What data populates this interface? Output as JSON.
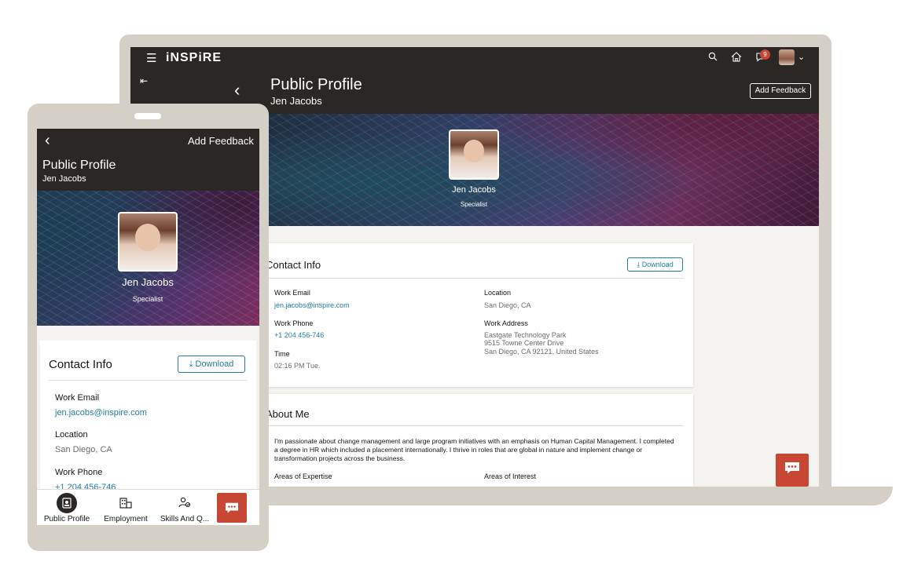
{
  "desktop": {
    "app_name": "iNSPiRE",
    "notification_count": "9",
    "page_title": "Public Profile",
    "page_subtitle": "Jen Jacobs",
    "add_feedback_label": "Add Feedback",
    "profile": {
      "name": "Jen Jacobs",
      "role": "Specialist"
    },
    "contact": {
      "title": "Contact Info",
      "download_label": "Download",
      "work_email_label": "Work Email",
      "work_email": "jen.jacobs@inspire.com",
      "work_phone_label": "Work Phone",
      "work_phone": "+1 204 456-746",
      "time_label": "Time",
      "time": "02:16 PM Tue.",
      "location_label": "Location",
      "location": "San Diego, CA",
      "work_address_label": "Work Address",
      "address_line1": "Eastgate Technology Park",
      "address_line2": "9515 Towne Center Drive",
      "address_line3": "San Diego, CA 92121, United States"
    },
    "about": {
      "title": "About Me",
      "text": "I'm passionate about change management and large program initiatives with an emphasis on Human Capital Management. I completed a degree in HR which included a placement internationally. I thrive in roles that are global in nature and implement change or transformation projects across the business.",
      "areas_of_expertise_label": "Areas of Expertise",
      "areas_of_interest_label": "Areas of Interest"
    }
  },
  "mobile": {
    "add_feedback_label": "Add Feedback",
    "page_title": "Public Profile",
    "page_subtitle": "Jen Jacobs",
    "profile": {
      "name": "Jen Jacobs",
      "role": "Specialist"
    },
    "contact": {
      "title": "Contact Info",
      "download_label": "Download",
      "work_email_label": "Work Email",
      "work_email": "jen.jacobs@inspire.com",
      "location_label": "Location",
      "location": "San Diego, CA",
      "work_phone_label": "Work Phone",
      "work_phone": "+1 204 456-746"
    },
    "nav": [
      {
        "label": "Public Profile",
        "icon": "id-badge-icon"
      },
      {
        "label": "Employment",
        "icon": "building-icon"
      },
      {
        "label": "Skills And Q...",
        "icon": "skills-icon"
      }
    ]
  },
  "colors": {
    "header": "#2b2724",
    "accent": "#227e9e",
    "chat": "#c74634"
  }
}
